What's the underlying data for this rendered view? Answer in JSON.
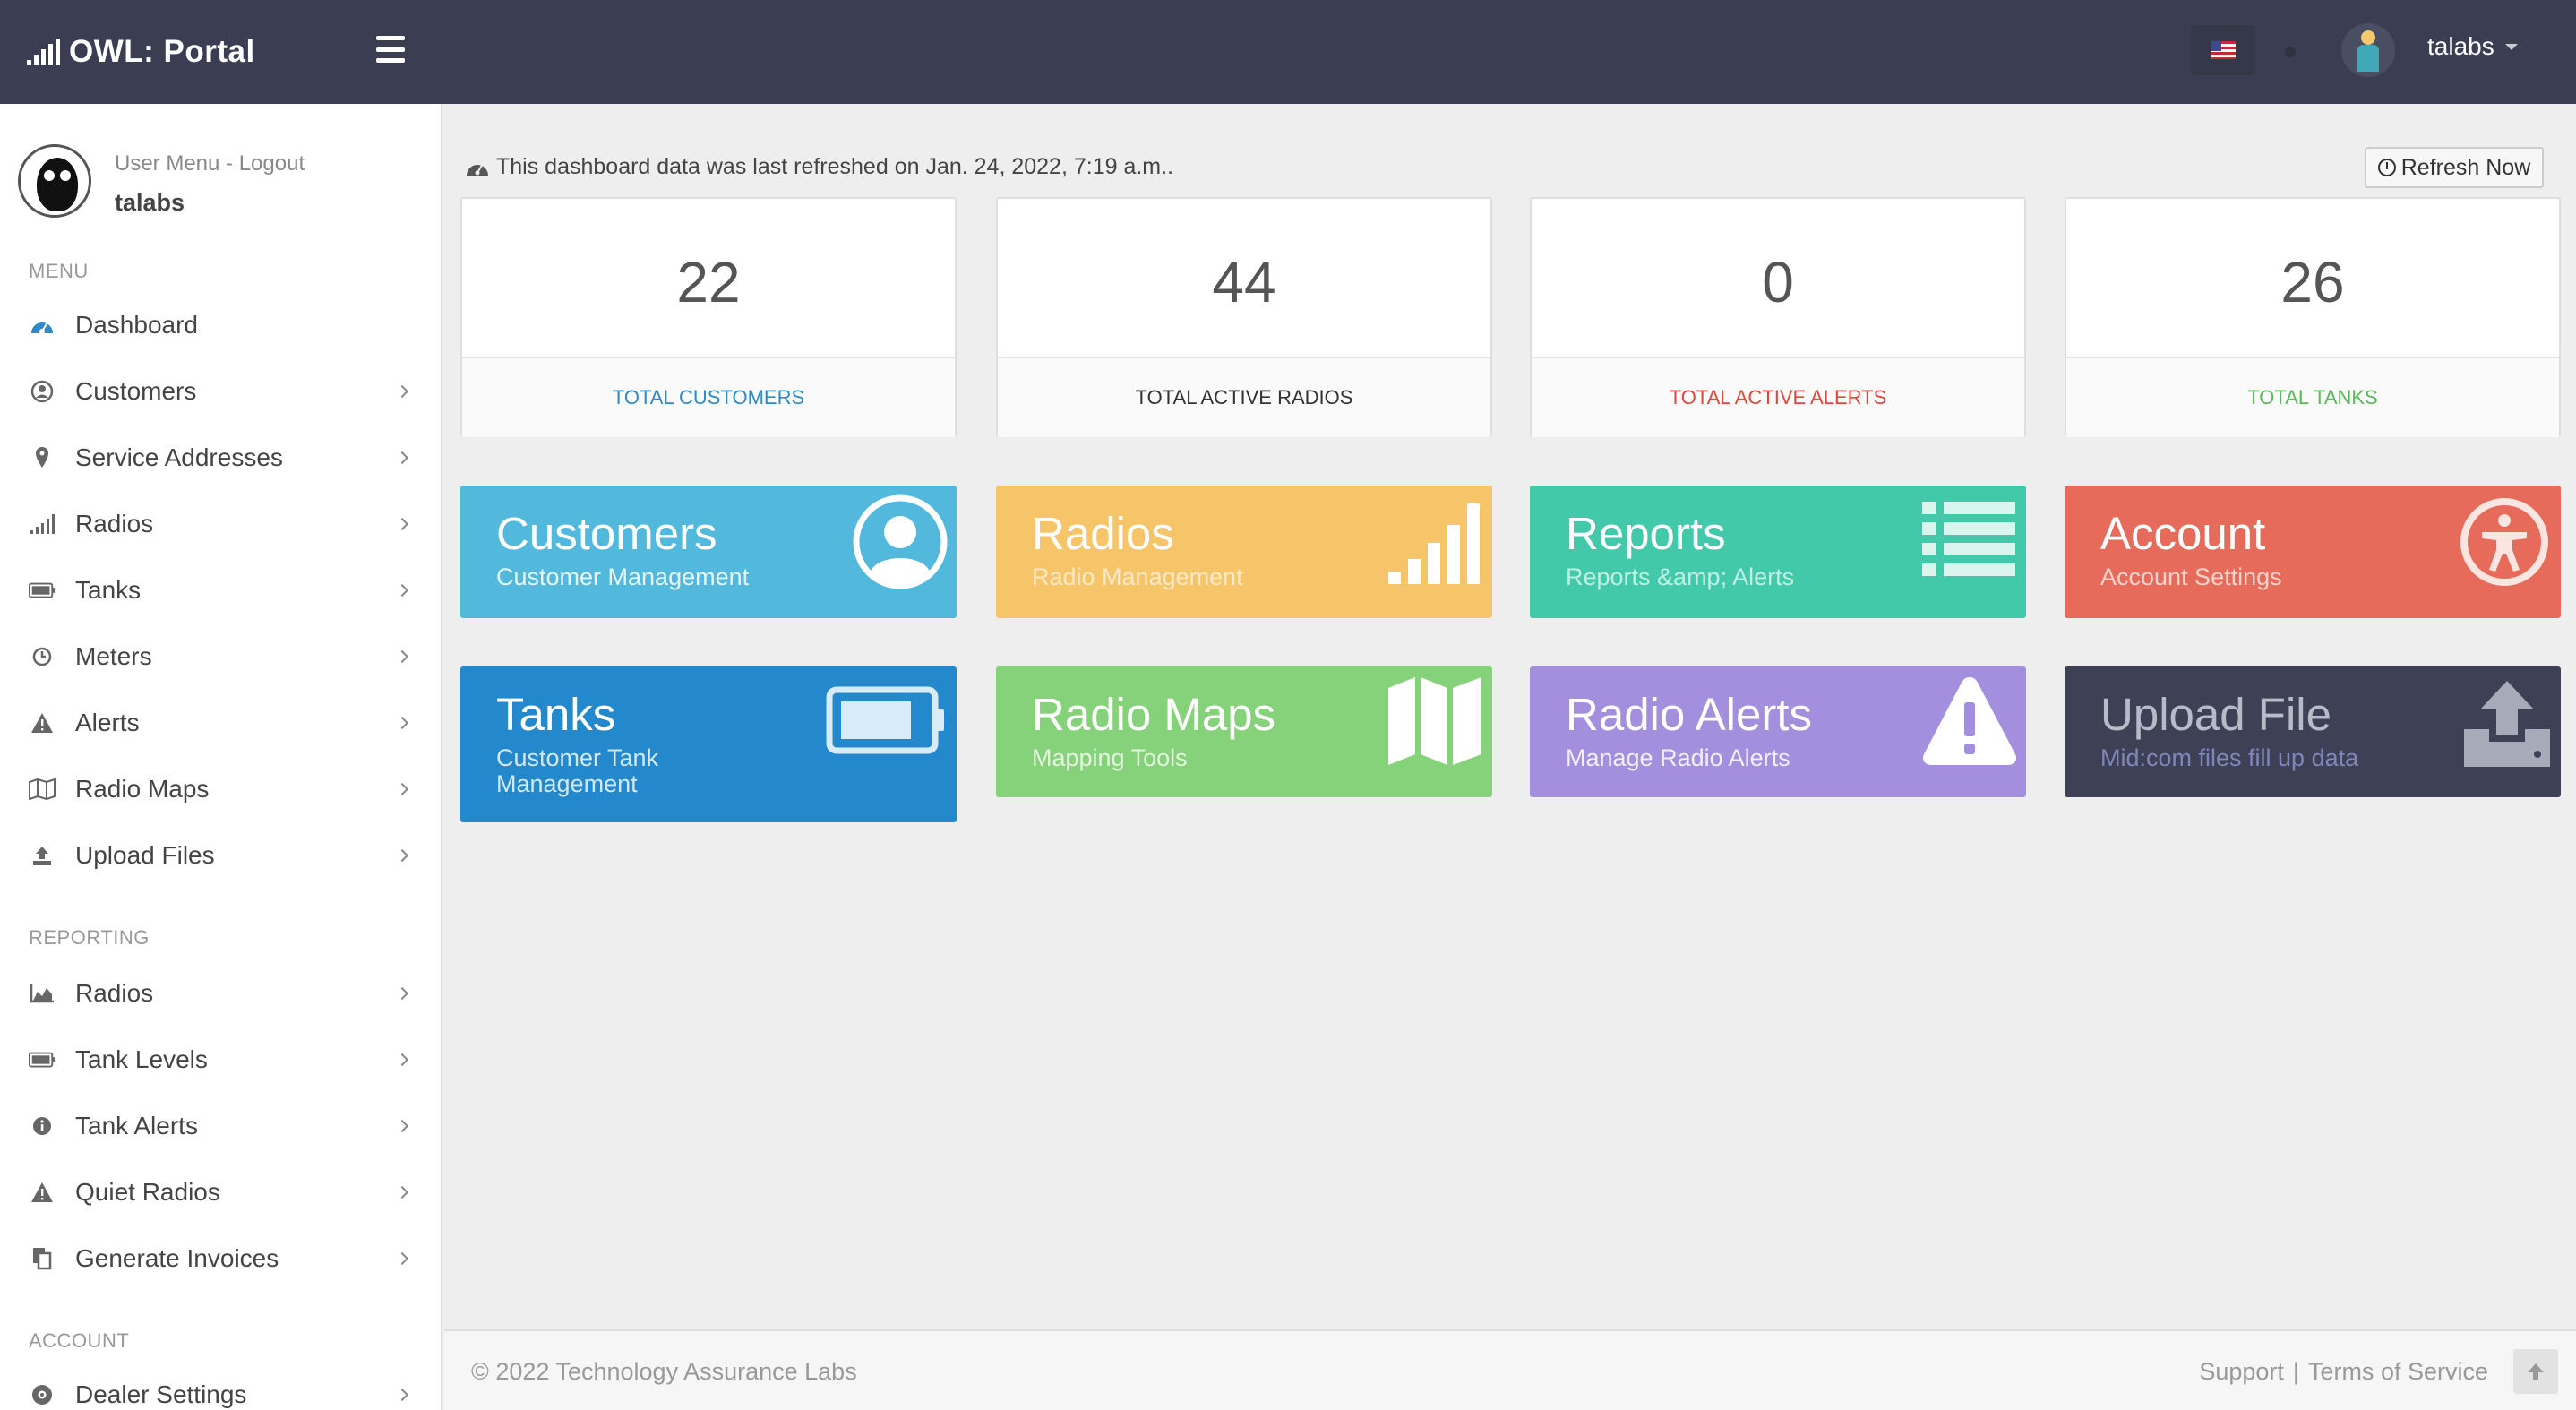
{
  "header": {
    "brand": "OWL: Portal",
    "user_name": "talabs"
  },
  "sidebar": {
    "profile": {
      "links": "User Menu - Logout",
      "name": "talabs"
    },
    "sections": {
      "menu": "MENU",
      "reporting": "REPORTING",
      "account": "ACCOUNT"
    },
    "menu": [
      {
        "label": "Dashboard",
        "icon": "dashboard-icon"
      },
      {
        "label": "Customers",
        "icon": "user-circle-icon"
      },
      {
        "label": "Service Addresses",
        "icon": "map-pin-icon"
      },
      {
        "label": "Radios",
        "icon": "signal-icon"
      },
      {
        "label": "Tanks",
        "icon": "battery-icon"
      },
      {
        "label": "Meters",
        "icon": "clock-icon"
      },
      {
        "label": "Alerts",
        "icon": "warning-icon"
      },
      {
        "label": "Radio Maps",
        "icon": "map-icon"
      },
      {
        "label": "Upload Files",
        "icon": "upload-icon"
      }
    ],
    "reporting": [
      {
        "label": "Radios",
        "icon": "area-chart-icon"
      },
      {
        "label": "Tank Levels",
        "icon": "battery-icon"
      },
      {
        "label": "Tank Alerts",
        "icon": "info-icon"
      },
      {
        "label": "Quiet Radios",
        "icon": "warning-icon"
      },
      {
        "label": "Generate Invoices",
        "icon": "copy-icon"
      }
    ],
    "account": [
      {
        "label": "Dealer Settings",
        "icon": "gear-circle-icon"
      }
    ]
  },
  "main": {
    "refresh_note": "This dashboard data was last refreshed on Jan. 24, 2022, 7:19 a.m..",
    "refresh_button": "Refresh Now",
    "stats": [
      {
        "value": "22",
        "label": "TOTAL CUSTOMERS",
        "color": "#2e8bc6"
      },
      {
        "value": "44",
        "label": "TOTAL ACTIVE RADIOS",
        "color": "#333333"
      },
      {
        "value": "0",
        "label": "TOTAL ACTIVE ALERTS",
        "color": "#e0483b"
      },
      {
        "value": "26",
        "label": "TOTAL TANKS",
        "color": "#5cb85c"
      }
    ],
    "tiles": [
      {
        "title": "Customers",
        "subtitle": "Customer Management",
        "color": "#52b8dc",
        "icon": "user-circle-icon"
      },
      {
        "title": "Radios",
        "subtitle": "Radio Management",
        "color": "#f6c56a",
        "icon": "signal-bars-icon"
      },
      {
        "title": "Reports",
        "subtitle": "Reports &amp; Alerts",
        "color": "#42c9a9",
        "icon": "list-icon"
      },
      {
        "title": "Account",
        "subtitle": "Account Settings",
        "color": "#e66b5a",
        "icon": "accessibility-icon"
      },
      {
        "title": "Tanks",
        "subtitle": "Customer Tank Management",
        "color": "#2389cc",
        "icon": "battery-icon"
      },
      {
        "title": "Radio Maps",
        "subtitle": "Mapping Tools",
        "color": "#86d27a",
        "icon": "map-icon"
      },
      {
        "title": "Radio Alerts",
        "subtitle": "Manage Radio Alerts",
        "color": "#a38fdd",
        "icon": "warning-icon"
      },
      {
        "title": "Upload File",
        "subtitle": "Mid:com files fill up data",
        "color": "#3e4156",
        "icon": "upload-tray-icon"
      }
    ]
  },
  "footer": {
    "copyright": "© 2022 Technology Assurance Labs",
    "support": "Support",
    "separator": "|",
    "terms": "Terms of Service"
  }
}
